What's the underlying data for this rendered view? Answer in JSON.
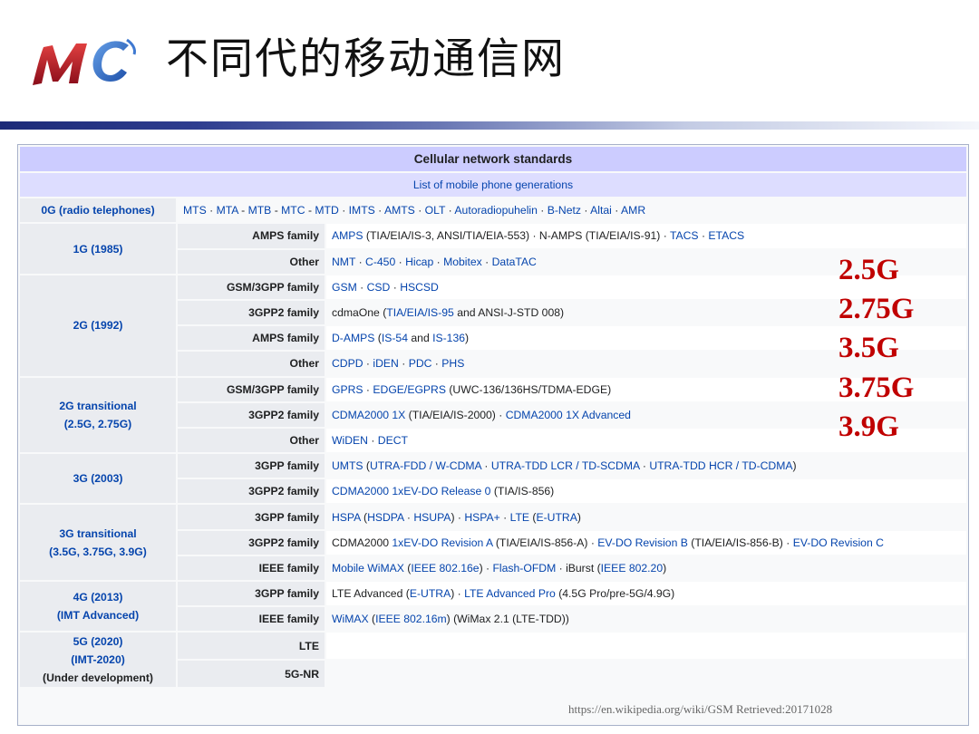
{
  "slide": {
    "title": "不同代的移动通信网",
    "logo_text": "MC",
    "source_url": "https://en.wikipedia.org/wiki/GSM  Retrieved:20171028",
    "generation_labels": [
      "2.5G",
      "2.75G",
      "3.5G",
      "3.75G",
      "3.9G"
    ]
  },
  "table": {
    "title": "Cellular network standards",
    "subtitle": "List of mobile phone generations",
    "row_0g": {
      "label": "0G (radio telephones)",
      "items": [
        {
          "t": "MTS",
          "c": "link"
        },
        {
          "t": " · ",
          "c": "sep"
        },
        {
          "t": "MTA",
          "c": "link"
        },
        {
          "t": " - ",
          "c": "sep"
        },
        {
          "t": "MTB",
          "c": "link"
        },
        {
          "t": " - ",
          "c": "sep"
        },
        {
          "t": "MTC",
          "c": "link"
        },
        {
          "t": " - ",
          "c": "sep"
        },
        {
          "t": "MTD",
          "c": "link"
        },
        {
          "t": " · ",
          "c": "sep"
        },
        {
          "t": "IMTS",
          "c": "link"
        },
        {
          "t": " · ",
          "c": "sep"
        },
        {
          "t": "AMTS",
          "c": "link"
        },
        {
          "t": " · ",
          "c": "sep"
        },
        {
          "t": "OLT",
          "c": "link"
        },
        {
          "t": " · ",
          "c": "sep"
        },
        {
          "t": "Autoradiopuhelin",
          "c": "link"
        },
        {
          "t": " · ",
          "c": "sep"
        },
        {
          "t": "B-Netz",
          "c": "link"
        },
        {
          "t": " · ",
          "c": "sep"
        },
        {
          "t": "Altai",
          "c": "link"
        },
        {
          "t": " · ",
          "c": "sep"
        },
        {
          "t": "AMR",
          "c": "link"
        }
      ]
    },
    "groups": [
      {
        "label": "1G (1985)",
        "rows": [
          {
            "family": "AMPS family",
            "items": [
              {
                "t": "AMPS",
                "c": "link"
              },
              {
                "t": " (TIA/EIA/IS-3, ANSI/TIA/EIA-553) · N-AMPS (TIA/EIA/IS-91) · ",
                "c": "text"
              },
              {
                "t": "TACS",
                "c": "link"
              },
              {
                "t": " · ",
                "c": "sep"
              },
              {
                "t": "ETACS",
                "c": "link"
              }
            ]
          },
          {
            "family": "Other",
            "items": [
              {
                "t": "NMT",
                "c": "link"
              },
              {
                "t": " · ",
                "c": "sep"
              },
              {
                "t": "C-450",
                "c": "link"
              },
              {
                "t": " · ",
                "c": "sep"
              },
              {
                "t": "Hicap",
                "c": "link"
              },
              {
                "t": " · ",
                "c": "sep"
              },
              {
                "t": "Mobitex",
                "c": "link"
              },
              {
                "t": " · ",
                "c": "sep"
              },
              {
                "t": "DataTAC",
                "c": "link"
              }
            ]
          }
        ]
      },
      {
        "label": "2G (1992)",
        "rows": [
          {
            "family": "GSM/3GPP family",
            "items": [
              {
                "t": "GSM",
                "c": "link"
              },
              {
                "t": " · ",
                "c": "sep"
              },
              {
                "t": "CSD",
                "c": "link"
              },
              {
                "t": " · ",
                "c": "sep"
              },
              {
                "t": "HSCSD",
                "c": "link"
              }
            ]
          },
          {
            "family": "3GPP2 family",
            "items": [
              {
                "t": "cdmaOne (",
                "c": "text"
              },
              {
                "t": "TIA/EIA/IS-95",
                "c": "link"
              },
              {
                "t": " and ANSI-J-STD 008)",
                "c": "text"
              }
            ]
          },
          {
            "family": "AMPS family",
            "items": [
              {
                "t": "D-AMPS",
                "c": "link"
              },
              {
                "t": " (",
                "c": "text"
              },
              {
                "t": "IS-54",
                "c": "link"
              },
              {
                "t": " and ",
                "c": "text"
              },
              {
                "t": "IS-136",
                "c": "link"
              },
              {
                "t": ")",
                "c": "text"
              }
            ]
          },
          {
            "family": "Other",
            "items": [
              {
                "t": "CDPD",
                "c": "link"
              },
              {
                "t": " · ",
                "c": "sep"
              },
              {
                "t": "iDEN",
                "c": "link"
              },
              {
                "t": " · ",
                "c": "sep"
              },
              {
                "t": "PDC",
                "c": "link"
              },
              {
                "t": " · ",
                "c": "sep"
              },
              {
                "t": "PHS",
                "c": "link"
              }
            ]
          }
        ]
      },
      {
        "label": "2G transitional",
        "label2": "(2.5G, 2.75G)",
        "rows": [
          {
            "family": "GSM/3GPP family",
            "items": [
              {
                "t": "GPRS",
                "c": "link"
              },
              {
                "t": " · ",
                "c": "sep"
              },
              {
                "t": "EDGE/EGPRS",
                "c": "link"
              },
              {
                "t": " (UWC-136/136HS/TDMA-EDGE)",
                "c": "text"
              }
            ]
          },
          {
            "family": "3GPP2 family",
            "items": [
              {
                "t": "CDMA2000 1X",
                "c": "link"
              },
              {
                "t": " (TIA/EIA/IS-2000) · ",
                "c": "text"
              },
              {
                "t": "CDMA2000 1X Advanced",
                "c": "link"
              }
            ]
          },
          {
            "family": "Other",
            "items": [
              {
                "t": "WiDEN",
                "c": "link"
              },
              {
                "t": " · ",
                "c": "sep"
              },
              {
                "t": "DECT",
                "c": "link"
              }
            ]
          }
        ]
      },
      {
        "label": "3G (2003)",
        "rows": [
          {
            "family": "3GPP family",
            "items": [
              {
                "t": "UMTS",
                "c": "link"
              },
              {
                "t": " (",
                "c": "text"
              },
              {
                "t": "UTRA-FDD / W-CDMA",
                "c": "link"
              },
              {
                "t": " · ",
                "c": "sep"
              },
              {
                "t": "UTRA-TDD LCR / TD-SCDMA",
                "c": "link"
              },
              {
                "t": " · ",
                "c": "sep"
              },
              {
                "t": "UTRA-TDD HCR / TD-CDMA",
                "c": "link"
              },
              {
                "t": ")",
                "c": "text"
              }
            ]
          },
          {
            "family": "3GPP2 family",
            "items": [
              {
                "t": "CDMA2000 1xEV-DO Release 0",
                "c": "link"
              },
              {
                "t": " (TIA/IS-856)",
                "c": "text"
              }
            ]
          }
        ]
      },
      {
        "label": "3G transitional",
        "label2": "(3.5G, 3.75G, 3.9G)",
        "rows": [
          {
            "family": "3GPP family",
            "items": [
              {
                "t": "HSPA",
                "c": "link"
              },
              {
                "t": " (",
                "c": "text"
              },
              {
                "t": "HSDPA",
                "c": "link"
              },
              {
                "t": " · ",
                "c": "sep"
              },
              {
                "t": "HSUPA",
                "c": "link"
              },
              {
                "t": ") · ",
                "c": "text"
              },
              {
                "t": "HSPA+",
                "c": "link"
              },
              {
                "t": " · ",
                "c": "sep"
              },
              {
                "t": "LTE",
                "c": "link"
              },
              {
                "t": " (",
                "c": "text"
              },
              {
                "t": "E-UTRA",
                "c": "link"
              },
              {
                "t": ")",
                "c": "text"
              }
            ]
          },
          {
            "family": "3GPP2 family",
            "items": [
              {
                "t": "CDMA2000 ",
                "c": "text"
              },
              {
                "t": "1xEV-DO Revision A",
                "c": "link"
              },
              {
                "t": " (TIA/EIA/IS-856-A) · ",
                "c": "text"
              },
              {
                "t": "EV-DO Revision B",
                "c": "link"
              },
              {
                "t": " (TIA/EIA/IS-856-B) · ",
                "c": "text"
              },
              {
                "t": "EV-DO Revision C",
                "c": "link"
              }
            ]
          },
          {
            "family": "IEEE family",
            "items": [
              {
                "t": "Mobile WiMAX",
                "c": "link"
              },
              {
                "t": " (",
                "c": "text"
              },
              {
                "t": "IEEE 802.16e",
                "c": "link"
              },
              {
                "t": ") · ",
                "c": "text"
              },
              {
                "t": "Flash-OFDM",
                "c": "link"
              },
              {
                "t": " · iBurst (",
                "c": "text"
              },
              {
                "t": "IEEE 802.20",
                "c": "link"
              },
              {
                "t": ")",
                "c": "text"
              }
            ]
          }
        ]
      },
      {
        "label": "4G (2013)",
        "label2": "(IMT Advanced)",
        "rows": [
          {
            "family": "3GPP family",
            "items": [
              {
                "t": "LTE Advanced",
                "c": "text"
              },
              {
                "t": " (",
                "c": "text"
              },
              {
                "t": "E-UTRA",
                "c": "link"
              },
              {
                "t": ") · ",
                "c": "text"
              },
              {
                "t": "LTE Advanced Pro",
                "c": "link"
              },
              {
                "t": " (4.5G Pro/pre-5G/4.9G)",
                "c": "text"
              }
            ]
          },
          {
            "family": "IEEE family",
            "items": [
              {
                "t": "WiMAX",
                "c": "link"
              },
              {
                "t": " (",
                "c": "text"
              },
              {
                "t": "IEEE 802.16m",
                "c": "link"
              },
              {
                "t": ") (WiMax 2.1 (LTE-TDD))",
                "c": "text"
              }
            ]
          }
        ]
      },
      {
        "label": "5G (2020)",
        "label2": "(IMT-2020)",
        "label3": "(Under development)",
        "rows": [
          {
            "family": "LTE",
            "items": []
          },
          {
            "family": "5G-NR",
            "items": []
          }
        ]
      }
    ]
  }
}
